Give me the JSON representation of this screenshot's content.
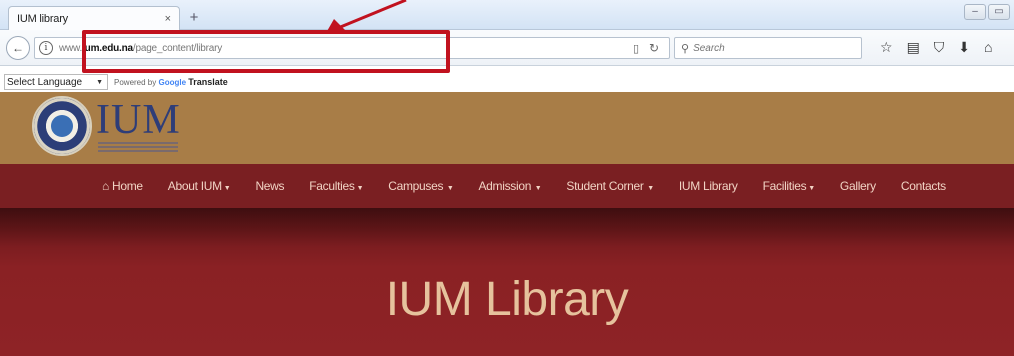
{
  "browser": {
    "tab_title": "IUM library",
    "tab_close": "×",
    "new_tab": "+",
    "back_glyph": "←",
    "url_prefix": "www.",
    "url_domain": "ium.edu.na",
    "url_path": "/page_content/library",
    "search_placeholder": "Search",
    "icons": [
      "reader-icon",
      "reload-icon",
      "bookmark-star-icon",
      "bookmarks-list-icon",
      "pocket-icon",
      "downloads-icon",
      "home-icon"
    ]
  },
  "translate": {
    "select_label": "Select Language",
    "powered_by": "Powered by",
    "google": "Google",
    "translate": "Translate"
  },
  "site": {
    "logo": "IUM",
    "nav": [
      {
        "label": "Home"
      },
      {
        "label": "About IUM"
      },
      {
        "label": "News"
      },
      {
        "label": "Faculties"
      },
      {
        "label": "Campuses"
      },
      {
        "label": "Admission"
      },
      {
        "label": "Student Corner"
      },
      {
        "label": "IUM Library"
      },
      {
        "label": "Facilities"
      },
      {
        "label": "Gallery"
      },
      {
        "label": "Contacts"
      }
    ],
    "hero_title": "IUM Library"
  },
  "colors": {
    "header_brown": "#a87d47",
    "nav_red": "#7a1f22",
    "hero_red": "#8e2326",
    "annotation_red": "#c1121f",
    "hero_text": "#e6c29d"
  }
}
